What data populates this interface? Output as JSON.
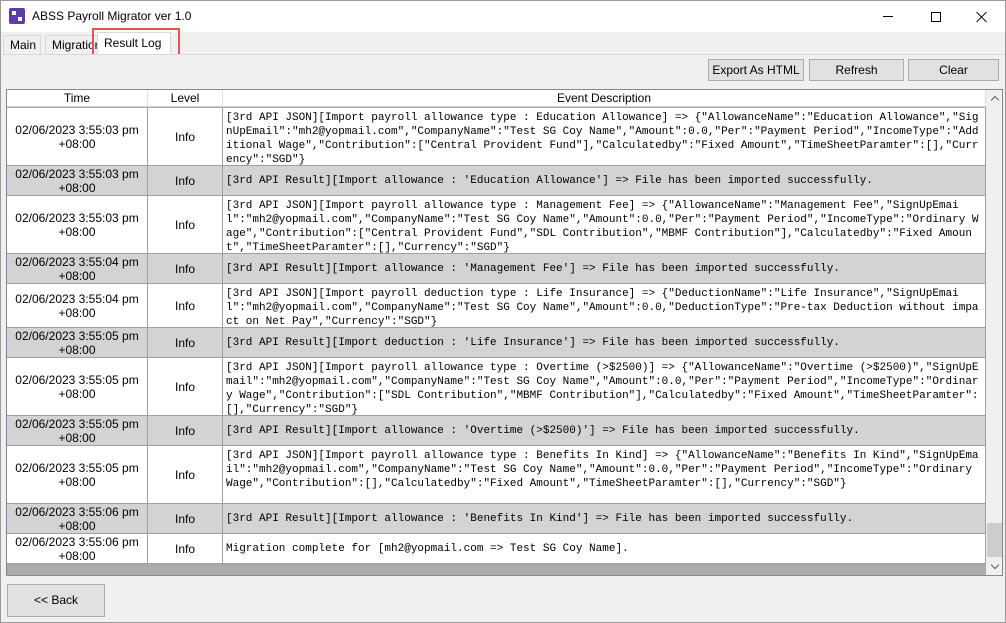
{
  "window": {
    "title": "ABSS Payroll Migrator ver 1.0",
    "app_icon": "abss-app-icon",
    "controls": {
      "minimize": "minimize-icon",
      "maximize": "maximize-icon",
      "close": "close-icon"
    }
  },
  "tabs": [
    {
      "label": "Main",
      "selected": false
    },
    {
      "label": "Migration",
      "selected": false
    },
    {
      "label": "Result Log",
      "selected": true
    }
  ],
  "toolbar": {
    "export_label": "Export As HTML",
    "refresh_label": "Refresh",
    "clear_label": "Clear"
  },
  "log": {
    "columns": [
      "Time",
      "Level",
      "Event Description"
    ],
    "rows": [
      {
        "time": "02/06/2023 3:55:03 pm\n+08:00",
        "level": "Info",
        "description": "[3rd API JSON][Import payroll allowance type : Education Allowance] => {\"AllowanceName\":\"Education Allowance\",\"SignUpEmail\":\"mh2@yopmail.com\",\"CompanyName\":\"Test SG Coy Name\",\"Amount\":0.0,\"Per\":\"Payment Period\",\"IncomeType\":\"Additional Wage\",\"Contribution\":[\"Central Provident Fund\"],\"Calculatedby\":\"Fixed Amount\",\"TimeSheetParamter\":[],\"Currency\":\"SGD\"}"
      },
      {
        "time": "02/06/2023 3:55:03 pm\n+08:00",
        "level": "Info",
        "description": "[3rd API Result][Import allowance : 'Education Allowance'] => File has been imported successfully."
      },
      {
        "time": "02/06/2023 3:55:03 pm\n+08:00",
        "level": "Info",
        "description": "[3rd API JSON][Import payroll allowance type : Management Fee] => {\"AllowanceName\":\"Management Fee\",\"SignUpEmail\":\"mh2@yopmail.com\",\"CompanyName\":\"Test SG Coy Name\",\"Amount\":0.0,\"Per\":\"Payment Period\",\"IncomeType\":\"Ordinary Wage\",\"Contribution\":[\"Central Provident Fund\",\"SDL Contribution\",\"MBMF Contribution\"],\"Calculatedby\":\"Fixed Amount\",\"TimeSheetParamter\":[],\"Currency\":\"SGD\"}"
      },
      {
        "time": "02/06/2023 3:55:04 pm\n+08:00",
        "level": "Info",
        "description": "[3rd API Result][Import allowance : 'Management Fee'] => File has been imported successfully."
      },
      {
        "time": "02/06/2023 3:55:04 pm\n+08:00",
        "level": "Info",
        "description": "[3rd API JSON][Import payroll deduction type : Life Insurance] => {\"DeductionName\":\"Life Insurance\",\"SignUpEmail\":\"mh2@yopmail.com\",\"CompanyName\":\"Test SG Coy Name\",\"Amount\":0.0,\"DeductionType\":\"Pre-tax Deduction without impact on Net Pay\",\"Currency\":\"SGD\"}"
      },
      {
        "time": "02/06/2023 3:55:05 pm\n+08:00",
        "level": "Info",
        "description": "[3rd API Result][Import deduction : 'Life Insurance'] => File has been imported successfully."
      },
      {
        "time": "02/06/2023 3:55:05 pm\n+08:00",
        "level": "Info",
        "description": "[3rd API JSON][Import payroll allowance type : Overtime (>$2500)] => {\"AllowanceName\":\"Overtime (>$2500)\",\"SignUpEmail\":\"mh2@yopmail.com\",\"CompanyName\":\"Test SG Coy Name\",\"Amount\":0.0,\"Per\":\"Payment Period\",\"IncomeType\":\"Ordinary Wage\",\"Contribution\":[\"SDL Contribution\",\"MBMF Contribution\"],\"Calculatedby\":\"Fixed Amount\",\"TimeSheetParamter\":[],\"Currency\":\"SGD\"}"
      },
      {
        "time": "02/06/2023 3:55:05 pm\n+08:00",
        "level": "Info",
        "description": "[3rd API Result][Import allowance : 'Overtime (>$2500)'] => File has been imported successfully."
      },
      {
        "time": "02/06/2023 3:55:05 pm\n+08:00",
        "level": "Info",
        "description": "[3rd API JSON][Import payroll allowance type : Benefits In Kind] => {\"AllowanceName\":\"Benefits In Kind\",\"SignUpEmail\":\"mh2@yopmail.com\",\"CompanyName\":\"Test SG Coy Name\",\"Amount\":0.0,\"Per\":\"Payment Period\",\"IncomeType\":\"Ordinary Wage\",\"Contribution\":[],\"Calculatedby\":\"Fixed Amount\",\"TimeSheetParamter\":[],\"Currency\":\"SGD\"}"
      },
      {
        "time": "02/06/2023 3:55:06 pm\n+08:00",
        "level": "Info",
        "description": "[3rd API Result][Import allowance : 'Benefits In Kind'] => File has been imported successfully."
      },
      {
        "time": "02/06/2023 3:55:06 pm\n+08:00",
        "level": "Info",
        "description": "Migration complete for [mh2@yopmail.com => Test SG Coy Name]."
      }
    ]
  },
  "footer": {
    "back_label": "<< Back"
  },
  "colors": {
    "highlight_box": "#e05555",
    "alt_row": "#d3d3d3",
    "grid_background": "#ababab"
  }
}
